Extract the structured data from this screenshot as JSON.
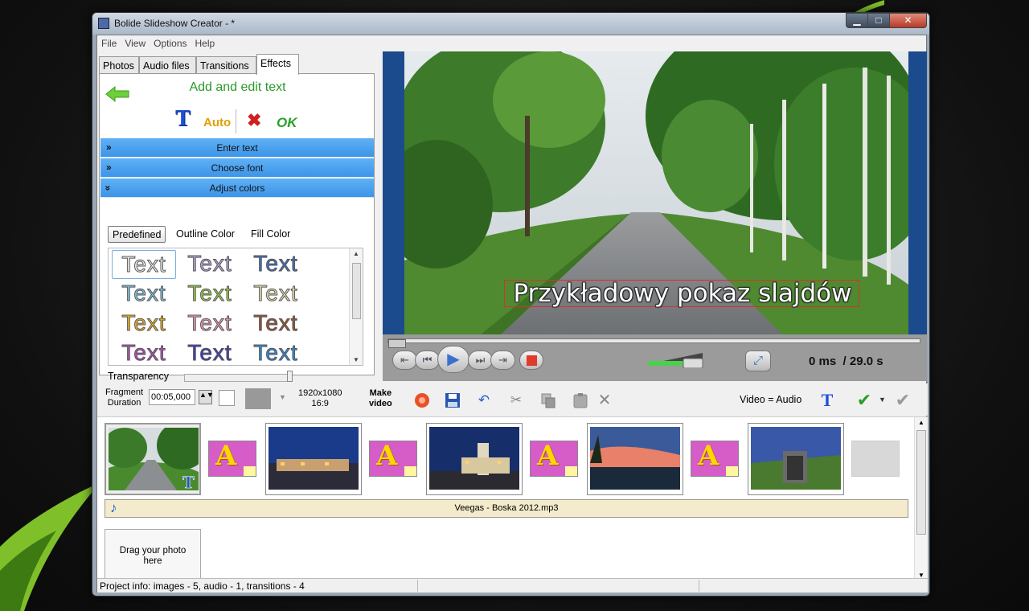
{
  "window": {
    "title": "Bolide Slideshow Creator - *",
    "min": "▁",
    "max": "□",
    "close": "✕"
  },
  "menu": [
    "File",
    "View",
    "Options",
    "Help"
  ],
  "tabs": [
    "Photos",
    "Audio files",
    "Transitions",
    "Effects"
  ],
  "active_tab": "Effects",
  "effects": {
    "title": "Add and edit text",
    "tools": {
      "text": "T",
      "auto": "Auto",
      "cancel": "✖",
      "ok": "OK"
    },
    "sections": [
      {
        "chevron": "»",
        "label": "Enter text"
      },
      {
        "chevron": "»",
        "label": "Choose font"
      },
      {
        "chevron": "»",
        "label": "Adjust colors"
      }
    ],
    "color_tabs": [
      "Predefined",
      "Outline Color",
      "Fill Color"
    ],
    "style_sample": "Text",
    "style_colors": [
      "#f4f4f4",
      "#b9a5e0",
      "#3f6fc9",
      "#7fc7e6",
      "#9ad33a",
      "#efe2b0",
      "#f4b418",
      "#ef9ab2",
      "#a0522d",
      "#b44fc2",
      "#3a3ad0",
      "#2a8ee6"
    ],
    "transparency_label": "Transparency",
    "transparency": 0.97
  },
  "preview": {
    "caption": "Przykładowy pokaz slajdów",
    "time_current": "0 ms",
    "time_total": "/ 29.0 s",
    "position": 0.0,
    "volume": 0.8
  },
  "player_icons": {
    "first": "⇤",
    "prev": "⏮",
    "play": "▶",
    "next": "⏭",
    "last": "⇥"
  },
  "toolbar": {
    "fragment_label": [
      "Fragment",
      "Duration"
    ],
    "fragment_value": "00:05,000",
    "resolution": [
      "1920x1080",
      "16:9"
    ],
    "make_video": [
      "Make",
      "video"
    ],
    "video_audio": "Video = Audio",
    "icons": [
      "record-icon",
      "save-icon",
      "undo-icon",
      "cut-icon",
      "copy-icon",
      "paste-icon",
      "delete-icon",
      "text-icon",
      "apply-icon",
      "apply-all-icon"
    ]
  },
  "timeline": {
    "audio_file": "Veegas - Boska 2012.mp3",
    "drag_hint": [
      "Drag your photo",
      "here"
    ],
    "transition_letter": "A"
  },
  "status": "Project info: images - 5, audio - 1, transitions - 4"
}
